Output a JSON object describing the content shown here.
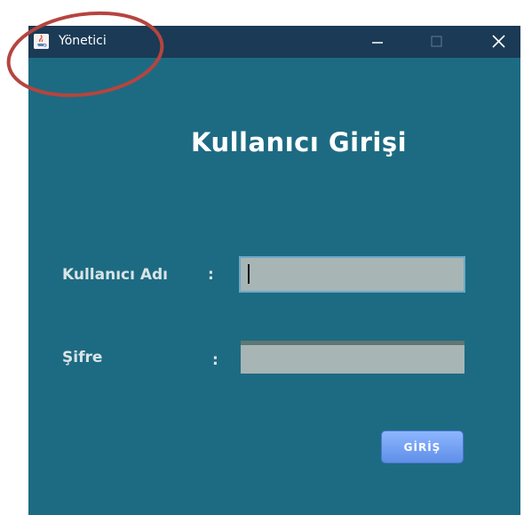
{
  "window": {
    "title": "Yönetici",
    "app_icon": "java-coffee-icon",
    "controls": [
      "minimize-icon",
      "maximize-icon",
      "close-icon"
    ]
  },
  "form": {
    "heading": "Kullanıcı Girişi",
    "username_label": "Kullanıcı Adı",
    "password_label": "Şifre",
    "colon": ":",
    "username_value": "",
    "password_value": "",
    "submit_label": "GİRİŞ"
  },
  "colors": {
    "window_bg": "#1d6b82",
    "titlebar_bg": "#1b3a55",
    "field_bg": "#a7b5b5",
    "button_bg": "#6f9ff0",
    "annotation_circle": "#b5453f"
  }
}
